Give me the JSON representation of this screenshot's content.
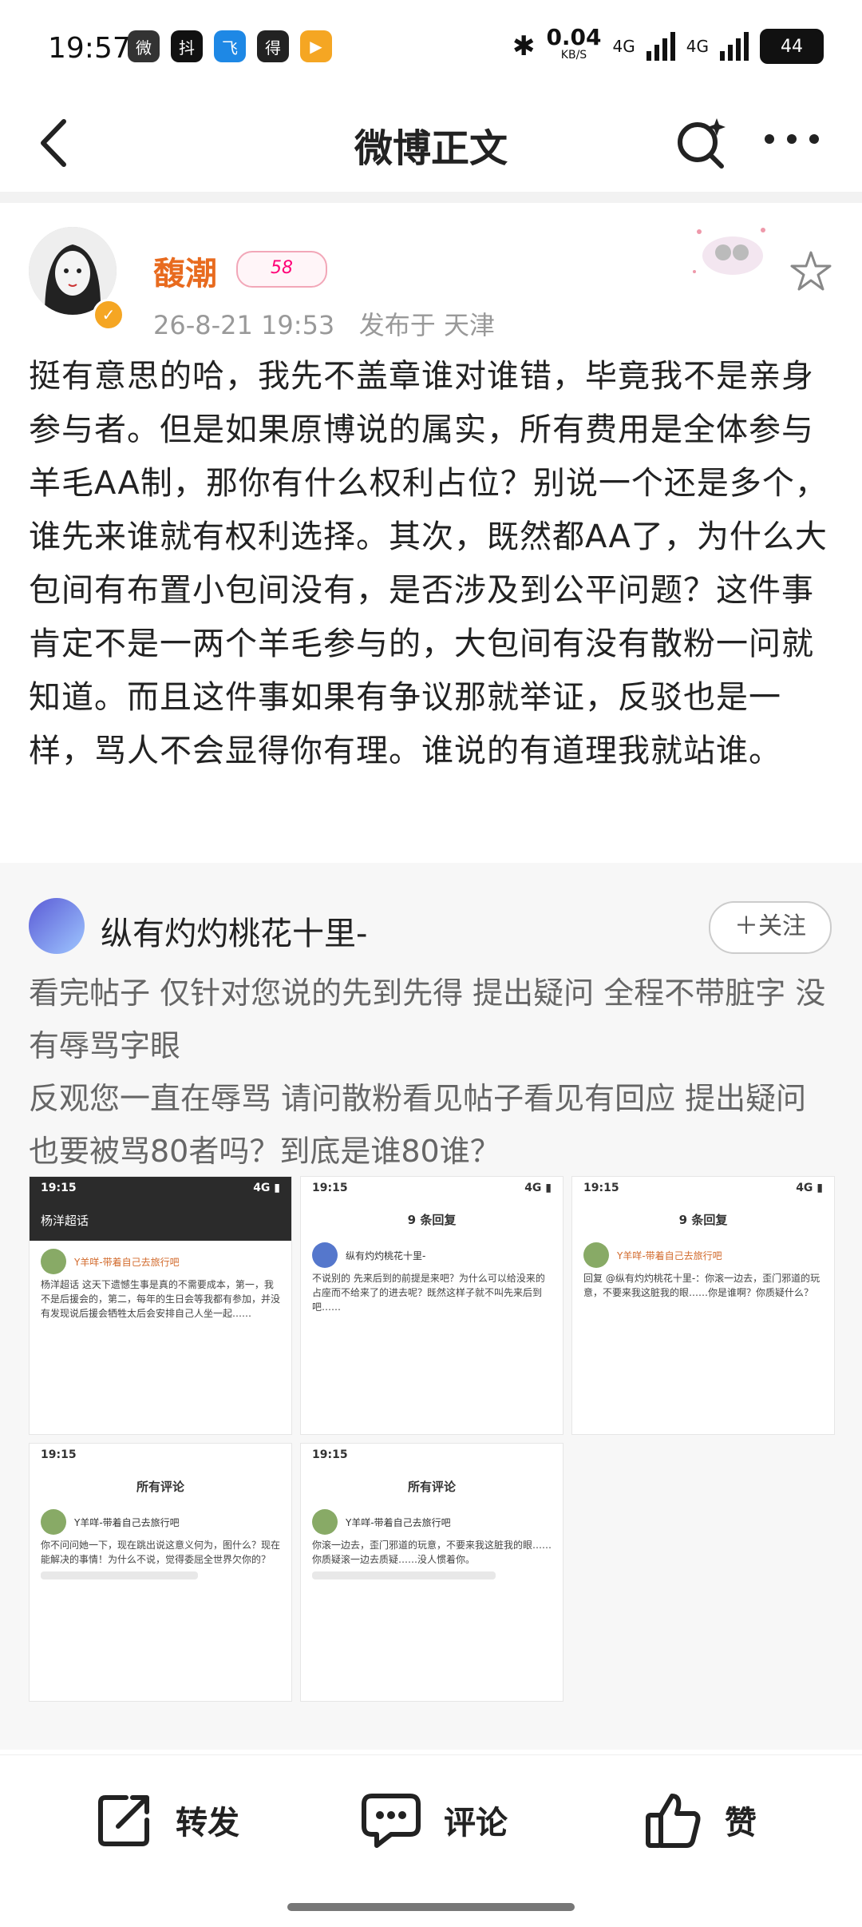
{
  "status": {
    "time": "19:57",
    "apps": [
      "微",
      "抖",
      "飞",
      "得",
      "▶"
    ],
    "net_speed": "0.04",
    "net_unit": "KB/S",
    "net1": "4G",
    "net2": "4G",
    "battery": "44"
  },
  "header": {
    "title": "微博正文"
  },
  "post": {
    "author": "馥潮",
    "level": "58",
    "date": "26-8-21 19:53",
    "location": "发布于 天津",
    "text": "挺有意思的哈，我先不盖章谁对谁错，毕竟我不是亲身参与者。但是如果原博说的属实，所有费用是全体参与羊毛AA制，那你有什么权利占位？别说一个还是多个，谁先来谁就有权利选择。其次，既然都AA了，为什么大包间有布置小包间没有，是否涉及到公平问题？这件事肯定不是一两个羊毛参与的，大包间有没有散粉一问就知道。而且这件事如果有争议那就举证，反驳也是一样，骂人不会显得你有理。谁说的有道理我就站谁。"
  },
  "comment": {
    "user": "纵有灼灼桃花十里-",
    "follow_label": "＋关注",
    "text1": "看完帖子 仅针对您说的先到先得 提出疑问 全程不带脏字 没有辱骂字眼",
    "text2": "反观您一直在辱骂 请问散粉看见帖子看见有回应 提出疑问 也要被骂80者吗？到底是谁80谁？"
  },
  "thumbnails": [
    {
      "time": "19:15",
      "title": "杨洋超话",
      "user": "Y羊咩-带着自己去旅行吧",
      "body": "杨洋超话 这天下遗憾生事是真的不需要成本，第一，我不是后援会的，第二，每年的生日会等我都有参加，并没有发现说后援会牺牲太后会安排自己人坐一起……"
    },
    {
      "time": "19:15",
      "title": "9 条回复",
      "user": "纵有灼灼桃花十里-",
      "body": "不说别的 先来后到的前提是来吧？为什么可以给没来的占座而不给来了的进去呢？既然这样子就不叫先来后到吧……"
    },
    {
      "time": "19:15",
      "title": "9 条回复",
      "user": "Y羊咩-带着自己去旅行吧",
      "body": "回复 @纵有灼灼桃花十里-：你滚一边去，歪门邪道的玩意，不要来我这脏我的眼……你是谁啊？你质疑什么？"
    },
    {
      "time": "19:15",
      "title": "所有评论",
      "user": "Y羊咩-带着自己去旅行吧",
      "body": "你不问问她一下，现在跳出说这意义何为，图什么？现在能解决的事情！为什么不说，觉得委屈全世界欠你的？"
    },
    {
      "time": "19:15",
      "title": "所有评论",
      "user": "Y羊咩-带着自己去旅行吧",
      "body": "你滚一边去，歪门邪道的玩意，不要来我这脏我的眼……你质疑滚一边去质疑……没人惯着你。"
    }
  ],
  "actions": {
    "repost": "转发",
    "comment": "评论",
    "like": "赞"
  }
}
